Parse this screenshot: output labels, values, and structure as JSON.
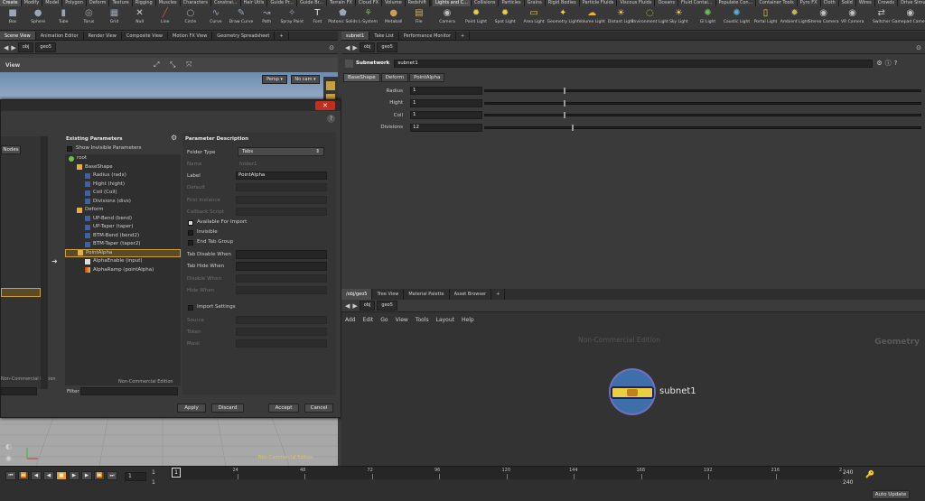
{
  "shelf_tabs_left": [
    "Create",
    "Modify",
    "Model",
    "Polygon",
    "Deform",
    "Texture",
    "Rigging",
    "Muscles",
    "Characters",
    "Constrai...",
    "Hair Utils",
    "Guide Pr...",
    "Guide Br...",
    "Terrain FX",
    "Cloud FX",
    "Volume",
    "Redshift"
  ],
  "shelf_tabs_right": [
    "Lights and C...",
    "Collisions",
    "Particles",
    "Grains",
    "Rigid Bodies",
    "Particle Fluids",
    "Viscous Fluids",
    "Oceans",
    "Fluid Contai...",
    "Populate Con...",
    "Container Tools",
    "Pyro FX",
    "Cloth",
    "Solid",
    "Wires",
    "Crowds",
    "Drive Simula..."
  ],
  "tools_left": [
    {
      "label": "Box",
      "icon": "box-icon",
      "glyph": "■",
      "color": "#9aa6b5"
    },
    {
      "label": "Sphere",
      "icon": "sphere-icon",
      "glyph": "●",
      "color": "#9aa6b5"
    },
    {
      "label": "Tube",
      "icon": "tube-icon",
      "glyph": "▮",
      "color": "#9aa6b5"
    },
    {
      "label": "Torus",
      "icon": "torus-icon",
      "glyph": "◎",
      "color": "#9aa6b5"
    },
    {
      "label": "Grid",
      "icon": "grid-icon",
      "glyph": "▦",
      "color": "#9aa6b5"
    },
    {
      "label": "Null",
      "icon": "null-icon",
      "glyph": "✕",
      "color": "#d0d0d0"
    },
    {
      "label": "Line",
      "icon": "line-icon",
      "glyph": "╱",
      "color": "#d05050"
    },
    {
      "label": "Circle",
      "icon": "circle-icon",
      "glyph": "○",
      "color": "#9aa6b5"
    },
    {
      "label": "Curve",
      "icon": "curve-icon",
      "glyph": "∿",
      "color": "#9aa6b5"
    },
    {
      "label": "Draw Curve",
      "icon": "draw-curve-icon",
      "glyph": "✎",
      "color": "#9aa6b5"
    },
    {
      "label": "Path",
      "icon": "path-icon",
      "glyph": "↝",
      "color": "#9aa6b5"
    },
    {
      "label": "Spray Paint",
      "icon": "spray-paint-icon",
      "glyph": "✧",
      "color": "#9aa6b5"
    },
    {
      "label": "Font",
      "icon": "font-icon",
      "glyph": "T",
      "color": "#e0e0e0"
    },
    {
      "label": "Platonic Solids",
      "icon": "platonic-icon",
      "glyph": "⬟",
      "color": "#9aa6b5"
    },
    {
      "label": "L-System",
      "icon": "lsystem-icon",
      "glyph": "⚘",
      "color": "#6fb04f"
    },
    {
      "label": "Metaball",
      "icon": "metaball-icon",
      "glyph": "●",
      "color": "#c8a050"
    },
    {
      "label": "File",
      "icon": "file-icon",
      "glyph": "▤",
      "color": "#d0b060"
    }
  ],
  "tools_right": [
    {
      "label": "Camera",
      "icon": "camera-icon",
      "glyph": "◉",
      "color": "#c0c0c0"
    },
    {
      "label": "Point Light",
      "icon": "point-light-icon",
      "glyph": "✹",
      "color": "#f0d040"
    },
    {
      "label": "Spot Light",
      "icon": "spot-light-icon",
      "glyph": "✹",
      "color": "#f0d040"
    },
    {
      "label": "Area Light",
      "icon": "area-light-icon",
      "glyph": "▭",
      "color": "#f0d040"
    },
    {
      "label": "Geometry Light",
      "icon": "geometry-light-icon",
      "glyph": "✦",
      "color": "#f0d040"
    },
    {
      "label": "Volume Light",
      "icon": "volume-light-icon",
      "glyph": "☁",
      "color": "#f0b040"
    },
    {
      "label": "Distant Light",
      "icon": "distant-light-icon",
      "glyph": "☀",
      "color": "#f0d040"
    },
    {
      "label": "Environment Light",
      "icon": "environment-light-icon",
      "glyph": "◌",
      "color": "#f0d040"
    },
    {
      "label": "Sky Light",
      "icon": "sky-light-icon",
      "glyph": "☀",
      "color": "#f0d040"
    },
    {
      "label": "GI Light",
      "icon": "gi-light-icon",
      "glyph": "✺",
      "color": "#70c060"
    },
    {
      "label": "Caustic Light",
      "icon": "caustic-light-icon",
      "glyph": "✺",
      "color": "#60b0e0"
    },
    {
      "label": "Portal Light",
      "icon": "portal-light-icon",
      "glyph": "▯",
      "color": "#f0d040"
    },
    {
      "label": "Ambient Light",
      "icon": "ambient-light-icon",
      "glyph": "✹",
      "color": "#c0c040"
    },
    {
      "label": "Stereo Camera",
      "icon": "stereo-camera-icon",
      "glyph": "◉",
      "color": "#c0c0c0"
    },
    {
      "label": "VR Camera",
      "icon": "vr-camera-icon",
      "glyph": "◉",
      "color": "#c0c0c0"
    },
    {
      "label": "Switcher",
      "icon": "switcher-icon",
      "glyph": "⇄",
      "color": "#c0c0c0"
    },
    {
      "label": "Gamepad Camera",
      "icon": "gamepad-camera-icon",
      "glyph": "◉",
      "color": "#c0c0c0"
    }
  ],
  "left_pane_tabs": [
    "Scene View",
    "Animation Editor",
    "Render View",
    "Composite View",
    "Motion FX View",
    "Geometry Spreadsheet"
  ],
  "right_pane_tabs": [
    "subnet1",
    "Take List",
    "Performance Monitor"
  ],
  "path": {
    "obj": "obj",
    "geo": "geo5"
  },
  "viewport": {
    "title": "View",
    "persp": "Persp ▾",
    "cam": "No cam ▾",
    "watermark": "Non-Commercial Edition"
  },
  "dialog": {
    "existing_header": "Existing Parameters",
    "show_invisible": "Show Invisible Parameters",
    "desc_header": "Parameter Description",
    "left_label": "Nodes",
    "left_watermark": "Non-Commercial Edition",
    "tree": [
      {
        "label": "root",
        "depth": 0,
        "icon": "root-icon",
        "sel": false
      },
      {
        "label": "BaseShape",
        "depth": 1,
        "icon": "folder-icon",
        "sel": false
      },
      {
        "label": "Radius (radx)",
        "depth": 2,
        "icon": "param-icon",
        "sel": false
      },
      {
        "label": "Hight (hight)",
        "depth": 2,
        "icon": "param-icon",
        "sel": false
      },
      {
        "label": "Coil (Coil)",
        "depth": 2,
        "icon": "param-icon",
        "sel": false
      },
      {
        "label": "Divisions (divs)",
        "depth": 2,
        "icon": "param-icon",
        "sel": false
      },
      {
        "label": "Deform",
        "depth": 1,
        "icon": "folder-icon",
        "sel": false
      },
      {
        "label": "UP-Bend (bend)",
        "depth": 2,
        "icon": "param-icon",
        "sel": false
      },
      {
        "label": "UP-Taper (taper)",
        "depth": 2,
        "icon": "param-icon",
        "sel": false
      },
      {
        "label": "BTM-Bend (bend2)",
        "depth": 2,
        "icon": "param-icon",
        "sel": false
      },
      {
        "label": "BTM-Taper (taper2)",
        "depth": 2,
        "icon": "param-icon",
        "sel": false
      },
      {
        "label": "PointAlpha",
        "depth": 1,
        "icon": "folder-icon",
        "sel": true
      },
      {
        "label": "AlphaEnable (input)",
        "depth": 2,
        "icon": "toggle-icon",
        "sel": false
      },
      {
        "label": "AlphaRamp (pointAlpha)",
        "depth": 2,
        "icon": "ramp-icon",
        "sel": false
      }
    ],
    "tree_watermark": "Non-Commercial Edition",
    "filter_label": "Filter",
    "folder_type_label": "Folder Type",
    "folder_type_value": "Tabs",
    "name_label": "Name",
    "name_value": "folder1",
    "label_label": "Label",
    "label_value": "PointAlpha",
    "default_label": "Default",
    "first_instance_label": "First Instance",
    "callback_label": "Callback Script",
    "available_label": "Available For Import",
    "invisible_label": "Invisible",
    "end_tab_label": "End Tab Group",
    "tab_disable_label": "Tab Disable When",
    "tab_hide_label": "Tab Hide When",
    "disable_when_label": "Disable When",
    "hide_when_label": "Hide When",
    "import_settings_label": "Import Settings",
    "source_label": "Source",
    "token_label": "Token",
    "mask_label": "Mask",
    "apply": "Apply",
    "discard": "Discard",
    "accept": "Accept",
    "cancel": "Cancel"
  },
  "params": {
    "type": "Subnetwork",
    "name": "subnet1",
    "tabs": [
      "BaseShape",
      "Deform",
      "PointAlpha"
    ],
    "fields": [
      {
        "label": "Radius",
        "value": "1",
        "fill": 0.18
      },
      {
        "label": "Hight",
        "value": "1",
        "fill": 0.18
      },
      {
        "label": "Coil",
        "value": "1",
        "fill": 0.18
      },
      {
        "label": "Divisions",
        "value": "12",
        "fill": 0.2
      }
    ]
  },
  "net_tabs": [
    "/obj/geo5",
    "Tree View",
    "Material Palette",
    "Asset Browser"
  ],
  "net_menu": [
    "Add",
    "Edit",
    "Go",
    "View",
    "Tools",
    "Layout",
    "Help"
  ],
  "net": {
    "watermark": "Non-Commercial Edition",
    "context": "Geometry",
    "node": "subnet1"
  },
  "timeline": {
    "frame": "1",
    "start": "1",
    "start2": "1",
    "ticks": [
      "24",
      "48",
      "72",
      "96",
      "120",
      "144",
      "168",
      "192",
      "216"
    ],
    "end_tick": "2",
    "end1": "240",
    "end2": "240",
    "auto_update": "Auto Update"
  }
}
